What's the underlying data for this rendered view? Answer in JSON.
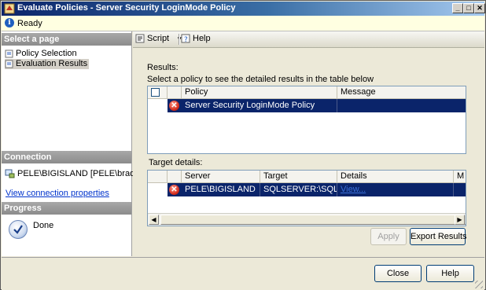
{
  "window": {
    "title": "Evaluate Policies - Server Security LoginMode Policy"
  },
  "status": {
    "text": "Ready"
  },
  "left": {
    "select_page_header": "Select a page",
    "pages": [
      "Policy Selection",
      "Evaluation Results"
    ],
    "connection_header": "Connection",
    "connection_text": "PELE\\BIGISLAND [PELE\\brad]",
    "view_connection_link": "View connection properties",
    "progress_header": "Progress",
    "progress_status": "Done"
  },
  "toolbar": {
    "script_label": "Script",
    "help_label": "Help"
  },
  "results": {
    "label": "Results:",
    "instruction": "Select a policy to see the detailed results in the table below",
    "columns": [
      "",
      "",
      "Policy",
      "Message"
    ],
    "rows": [
      {
        "policy": "Server Security LoginMode Policy",
        "message": ""
      }
    ]
  },
  "target": {
    "label": "Target details:",
    "columns": [
      "",
      "",
      "Server",
      "Target",
      "Details",
      "M"
    ],
    "rows": [
      {
        "server": "PELE\\BIGISLAND",
        "target": "SQLSERVER:\\SQL\\P...",
        "details": "View..."
      }
    ]
  },
  "buttons": {
    "apply": "Apply",
    "export": "Export Results",
    "close": "Close",
    "help": "Help"
  },
  "colors": {
    "selection": "#0a246a",
    "error": "#d42a1a"
  }
}
